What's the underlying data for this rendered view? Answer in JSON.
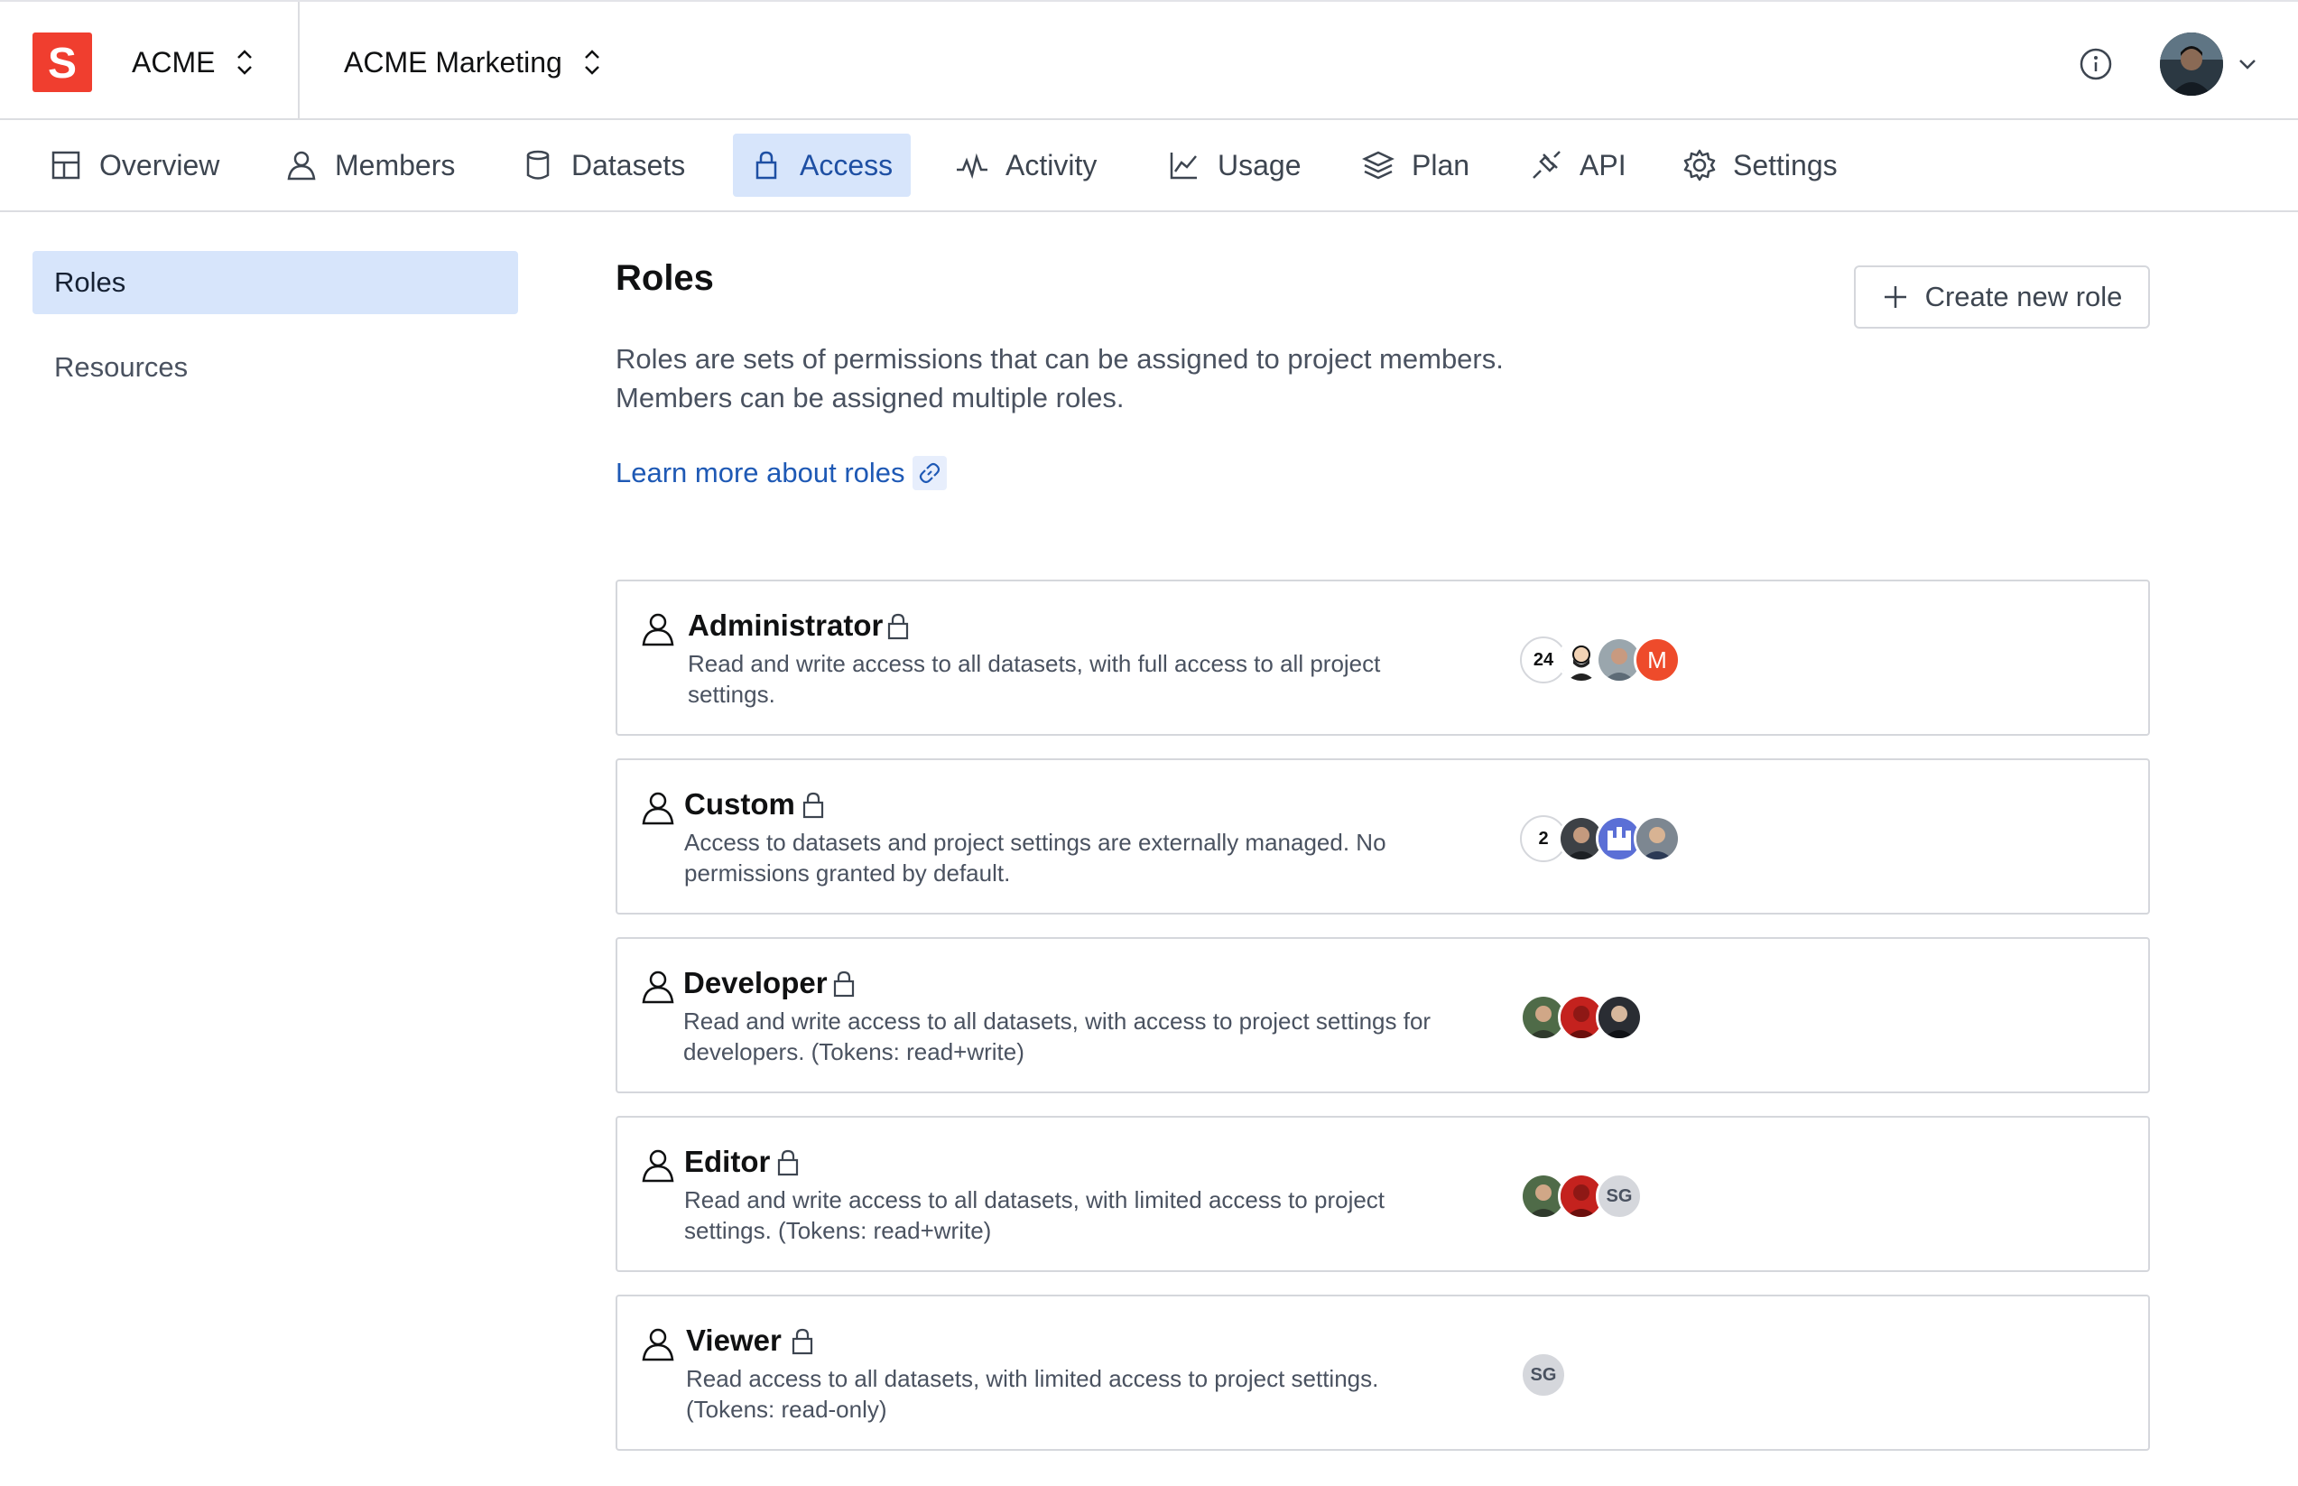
{
  "header": {
    "org_name": "ACME",
    "project_name": "ACME Marketing"
  },
  "nav": {
    "tabs": [
      {
        "label": "Overview",
        "icon": "overview-icon"
      },
      {
        "label": "Members",
        "icon": "members-icon"
      },
      {
        "label": "Datasets",
        "icon": "datasets-icon"
      },
      {
        "label": "Access",
        "icon": "lock-icon",
        "active": true
      },
      {
        "label": "Activity",
        "icon": "activity-icon"
      },
      {
        "label": "Usage",
        "icon": "usage-icon"
      },
      {
        "label": "Plan",
        "icon": "plan-icon"
      },
      {
        "label": "API",
        "icon": "api-icon"
      },
      {
        "label": "Settings",
        "icon": "settings-icon"
      }
    ]
  },
  "sidebar": {
    "items": [
      {
        "label": "Roles",
        "active": true
      },
      {
        "label": "Resources",
        "active": false
      }
    ]
  },
  "main": {
    "title": "Roles",
    "description": "Roles are sets of permissions that can be assigned to project members. Members can be assigned multiple roles.",
    "learn_more": "Learn more about roles",
    "create_button": "Create new role"
  },
  "roles": [
    {
      "name": "Administrator",
      "description": "Read and write access to all datasets, with full access to all project settings.",
      "count": "24",
      "members": [
        "photo",
        "photo",
        "M"
      ]
    },
    {
      "name": "Custom",
      "description": "Access to datasets and project settings are externally managed. No permissions granted by default.",
      "count": "2",
      "members": [
        "photo",
        "photo",
        "photo"
      ]
    },
    {
      "name": "Developer",
      "description": "Read and write access to all datasets, with access to project settings for developers. (Tokens: read+write)",
      "count": "",
      "members": [
        "photo",
        "photo",
        "photo"
      ]
    },
    {
      "name": "Editor",
      "description": "Read and write access to all datasets, with limited access to project settings. (Tokens: read+write)",
      "count": "",
      "members": [
        "photo",
        "photo",
        "SG"
      ]
    },
    {
      "name": "Viewer",
      "description": "Read access to all datasets, with limited access to project settings. (Tokens: read-only)",
      "count": "",
      "members": [
        "SG"
      ]
    }
  ],
  "colors": {
    "brand": "#f03e2f",
    "accent": "#1e59b5",
    "active_bg": "#d7e5fb",
    "border": "#d5d7dc"
  }
}
